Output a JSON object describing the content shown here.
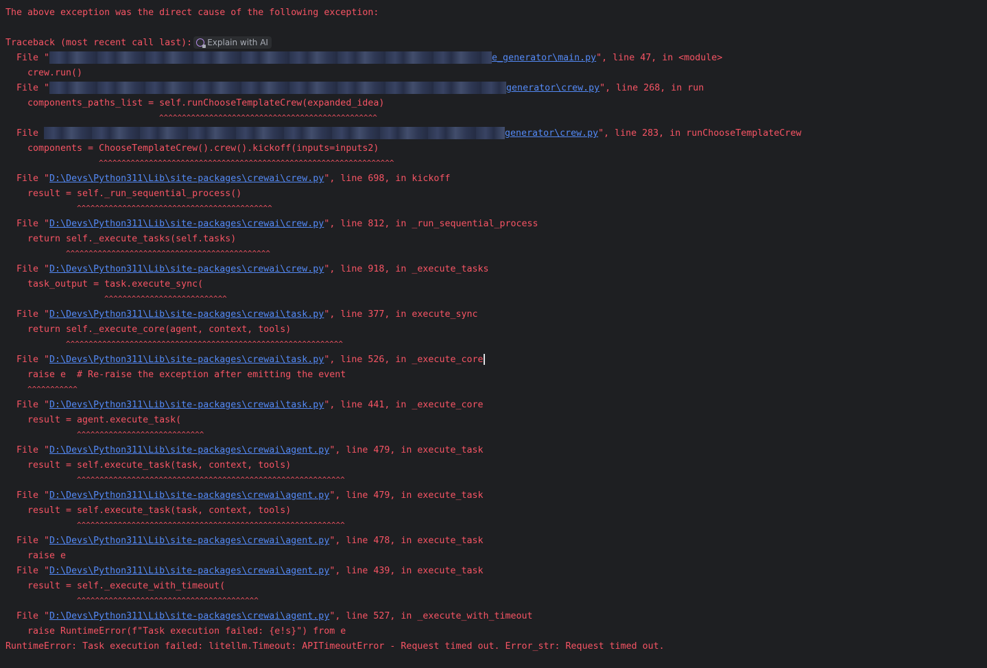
{
  "header": {
    "direct_cause": "The above exception was the direct cause of the following exception:",
    "traceback": "Traceback (most recent call last):",
    "explain_ai_label": "Explain with AI",
    "explain_ai_icon": "ai-sparkle-icon"
  },
  "frames": [
    {
      "file_prefix": "File \"",
      "path_visible": "e_generator\\main.py",
      "suffix": "\", line 47, in <module>",
      "code": "crew.run()",
      "caret": ""
    },
    {
      "file_prefix": "File \"",
      "path_visible": "generator\\crew.py",
      "suffix": "\", line 268, in run",
      "code": "components_paths_list = self.runChooseTemplateCrew(expanded_idea)",
      "caret": "^^^^^^^^^^^^^^^^^^^^^^^^^^^^^^^^^^^^^^^^^^^^^^^^"
    },
    {
      "file_prefix": "File ",
      "path_visible": "generator\\crew.py",
      "suffix": "\", line 283, in runChooseTemplateCrew",
      "code": "components = ChooseTemplateCrew().crew().kickoff(inputs=inputs2)",
      "caret": "^^^^^^^^^^^^^^^^^^^^^^^^^^^^^^^^^^^^^^^^^^^^^^^^^^^^^^^^^^^^^^^^^"
    },
    {
      "file_prefix": "File \"",
      "path_visible": "D:\\Devs\\Python311\\Lib\\site-packages\\crewai\\crew.py",
      "suffix": "\", line 698, in kickoff",
      "code": "result = self._run_sequential_process()",
      "caret": "^^^^^^^^^^^^^^^^^^^^^^^^^^^^^^^^^^^^^^^^^^^"
    },
    {
      "file_prefix": "File \"",
      "path_visible": "D:\\Devs\\Python311\\Lib\\site-packages\\crewai\\crew.py",
      "suffix": "\", line 812, in _run_sequential_process",
      "code": "return self._execute_tasks(self.tasks)",
      "caret": "^^^^^^^^^^^^^^^^^^^^^^^^^^^^^^^^^^^^^^^^^^^^^"
    },
    {
      "file_prefix": "File \"",
      "path_visible": "D:\\Devs\\Python311\\Lib\\site-packages\\crewai\\crew.py",
      "suffix": "\", line 918, in _execute_tasks",
      "code": "task_output = task.execute_sync(",
      "caret": "^^^^^^^^^^^^^^^^^^^^^^^^^^^"
    },
    {
      "file_prefix": "File \"",
      "path_visible": "D:\\Devs\\Python311\\Lib\\site-packages\\crewai\\task.py",
      "suffix": "\", line 377, in execute_sync",
      "code": "return self._execute_core(agent, context, tools)",
      "caret": "^^^^^^^^^^^^^^^^^^^^^^^^^^^^^^^^^^^^^^^^^^^^^^^^^^^^^^^^^^^^^"
    },
    {
      "file_prefix": "File \"",
      "path_visible": "D:\\Devs\\Python311\\Lib\\site-packages\\crewai\\task.py",
      "suffix": "\", line 526, in _execute_core",
      "code": "raise e  # Re-raise the exception after emitting the event",
      "caret": "^^^^^^^^^^^"
    },
    {
      "file_prefix": "File \"",
      "path_visible": "D:\\Devs\\Python311\\Lib\\site-packages\\crewai\\task.py",
      "suffix": "\", line 441, in _execute_core",
      "code": "result = agent.execute_task(",
      "caret": "^^^^^^^^^^^^^^^^^^^^^^^^^^^^"
    },
    {
      "file_prefix": "File \"",
      "path_visible": "D:\\Devs\\Python311\\Lib\\site-packages\\crewai\\agent.py",
      "suffix": "\", line 479, in execute_task",
      "code": "result = self.execute_task(task, context, tools)",
      "caret": "^^^^^^^^^^^^^^^^^^^^^^^^^^^^^^^^^^^^^^^^^^^^^^^^^^^^^^^^^^^"
    },
    {
      "file_prefix": "File \"",
      "path_visible": "D:\\Devs\\Python311\\Lib\\site-packages\\crewai\\agent.py",
      "suffix": "\", line 479, in execute_task",
      "code": "result = self.execute_task(task, context, tools)",
      "caret": "^^^^^^^^^^^^^^^^^^^^^^^^^^^^^^^^^^^^^^^^^^^^^^^^^^^^^^^^^^^"
    },
    {
      "file_prefix": "File \"",
      "path_visible": "D:\\Devs\\Python311\\Lib\\site-packages\\crewai\\agent.py",
      "suffix": "\", line 478, in execute_task",
      "code": "raise e",
      "caret": ""
    },
    {
      "file_prefix": "File \"",
      "path_visible": "D:\\Devs\\Python311\\Lib\\site-packages\\crewai\\agent.py",
      "suffix": "\", line 439, in execute_task",
      "code": "result = self._execute_with_timeout(",
      "caret": "^^^^^^^^^^^^^^^^^^^^^^^^^^^^^^^^^^^^^^^^"
    },
    {
      "file_prefix": "File \"",
      "path_visible": "D:\\Devs\\Python311\\Lib\\site-packages\\crewai\\agent.py",
      "suffix": "\", line 527, in _execute_with_timeout",
      "code": "raise RuntimeError(f\"Task execution failed: {e!s}\") from e",
      "caret": ""
    }
  ],
  "final_error": "RuntimeError: Task execution failed: litellm.Timeout: APITimeoutError - Request timed out. Error_str: Request timed out."
}
